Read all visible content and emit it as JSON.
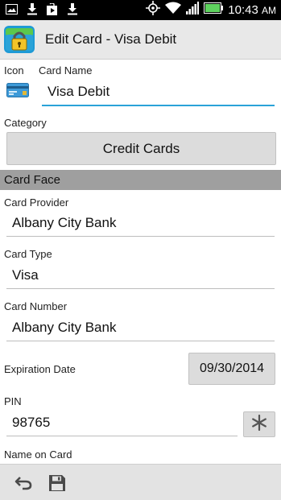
{
  "status_bar": {
    "time": "10:43",
    "ampm": "AM",
    "icons": [
      "image-icon",
      "download-icon",
      "play-store-icon",
      "download-icon",
      "gps-icon",
      "wifi-icon",
      "signal-icon",
      "battery-icon"
    ]
  },
  "action_bar": {
    "title": "Edit Card - Visa Debit",
    "app_icon": "lock-wallet-icon"
  },
  "form": {
    "icon_label": "Icon",
    "card_name_label": "Card Name",
    "card_name_value": "Visa Debit",
    "category_label": "Category",
    "category_value": "Credit Cards",
    "section_title": "Card Face",
    "card_provider_label": "Card Provider",
    "card_provider_value": "Albany City Bank",
    "card_type_label": "Card Type",
    "card_type_value": "Visa",
    "card_number_label": "Card Number",
    "card_number_value": "Albany City Bank",
    "expiration_label": "Expiration Date",
    "expiration_value": "09/30/2014",
    "pin_label": "PIN",
    "pin_value": "98765",
    "name_on_card_label": "Name on Card"
  },
  "bottom_bar": {
    "icons": [
      "undo-icon",
      "save-icon"
    ]
  },
  "colors": {
    "accent": "#2aa3d8",
    "section_bg": "#9f9f9f",
    "button_bg": "#dcdcdc"
  }
}
